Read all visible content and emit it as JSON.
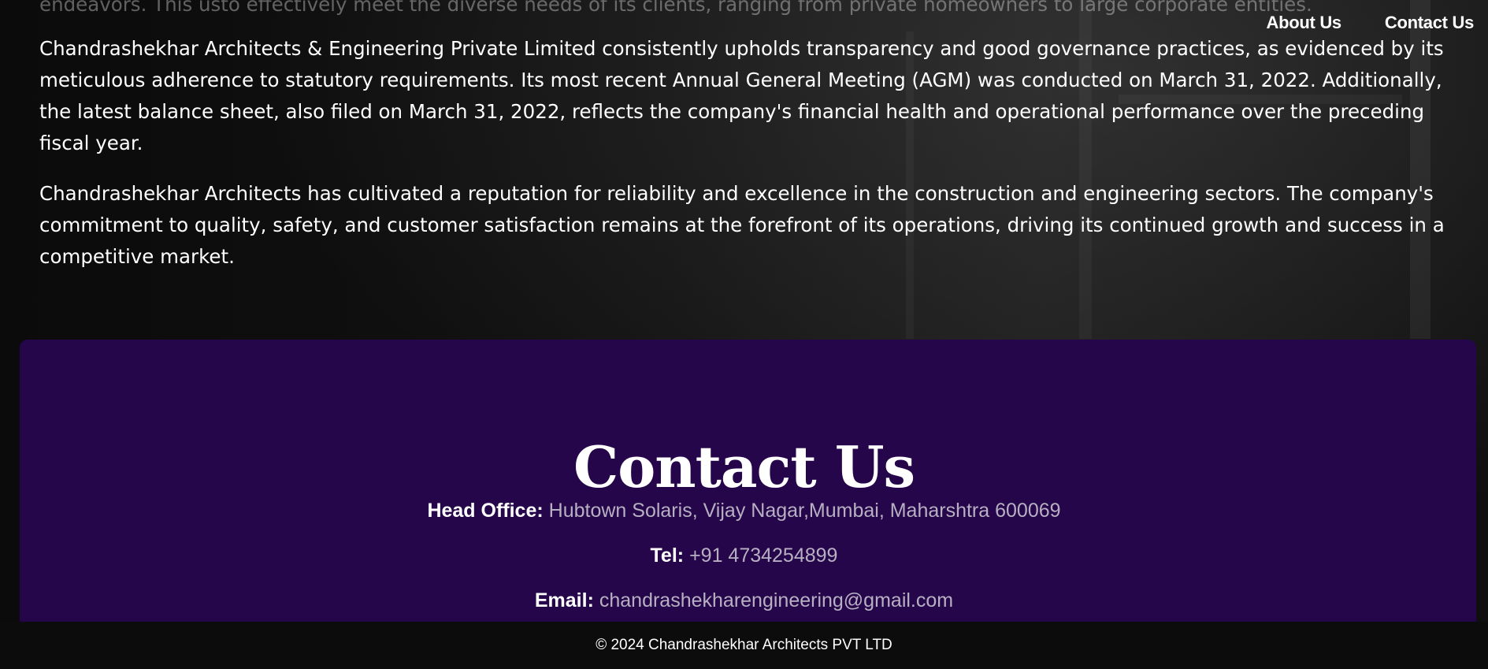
{
  "nav": {
    "items": [
      {
        "label": "About Us"
      },
      {
        "label": "Contact Us"
      }
    ]
  },
  "about": {
    "paragraphs": [
      "endeavors. This usto effectively meet the diverse needs of its clients, ranging from private homeowners to large corporate entities.",
      "Chandrashekhar Architects & Engineering Private Limited consistently upholds transparency and good governance practices, as evidenced by its meticulous adherence to statutory requirements. Its most recent Annual General Meeting (AGM) was conducted on March 31, 2022. Additionally, the latest balance sheet, also filed on March 31, 2022, reflects the company's financial health and operational performance over the preceding fiscal year.",
      "Chandrashekhar Architects has cultivated a reputation for reliability and excellence in the construction and engineering sectors. The company's commitment to quality, safety, and customer satisfaction remains at the forefront of its operations, driving its continued growth and success in a competitive market."
    ]
  },
  "contact": {
    "title": "Contact Us",
    "office_label": "Head Office:",
    "office_value": "Hubtown Solaris, Vijay Nagar,Mumbai, Maharshtra 600069",
    "tel_label": "Tel:",
    "tel_value": "+91 4734254899",
    "email_label": "Email:",
    "email_value": "chandrashekharengineering@gmail.com"
  },
  "footer": {
    "copyright": "© 2024 Chandrashekhar Architects PVT LTD"
  },
  "colors": {
    "contact_card_bg": "#26064a",
    "footer_bg": "#0c0c0d",
    "muted_value": "#b7b0c2"
  }
}
